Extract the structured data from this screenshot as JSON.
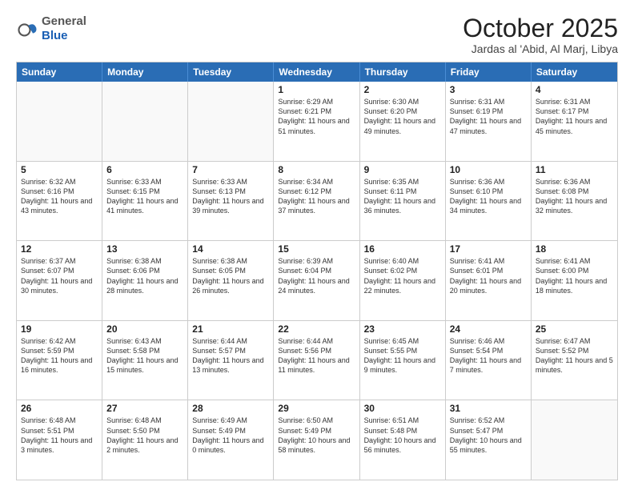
{
  "header": {
    "logo_general": "General",
    "logo_blue": "Blue",
    "month_title": "October 2025",
    "subtitle": "Jardas al 'Abid, Al Marj, Libya"
  },
  "calendar": {
    "days_of_week": [
      "Sunday",
      "Monday",
      "Tuesday",
      "Wednesday",
      "Thursday",
      "Friday",
      "Saturday"
    ],
    "rows": [
      [
        {
          "day": "",
          "sunrise": "",
          "sunset": "",
          "daylight": ""
        },
        {
          "day": "",
          "sunrise": "",
          "sunset": "",
          "daylight": ""
        },
        {
          "day": "",
          "sunrise": "",
          "sunset": "",
          "daylight": ""
        },
        {
          "day": "1",
          "sunrise": "Sunrise: 6:29 AM",
          "sunset": "Sunset: 6:21 PM",
          "daylight": "Daylight: 11 hours and 51 minutes."
        },
        {
          "day": "2",
          "sunrise": "Sunrise: 6:30 AM",
          "sunset": "Sunset: 6:20 PM",
          "daylight": "Daylight: 11 hours and 49 minutes."
        },
        {
          "day": "3",
          "sunrise": "Sunrise: 6:31 AM",
          "sunset": "Sunset: 6:19 PM",
          "daylight": "Daylight: 11 hours and 47 minutes."
        },
        {
          "day": "4",
          "sunrise": "Sunrise: 6:31 AM",
          "sunset": "Sunset: 6:17 PM",
          "daylight": "Daylight: 11 hours and 45 minutes."
        }
      ],
      [
        {
          "day": "5",
          "sunrise": "Sunrise: 6:32 AM",
          "sunset": "Sunset: 6:16 PM",
          "daylight": "Daylight: 11 hours and 43 minutes."
        },
        {
          "day": "6",
          "sunrise": "Sunrise: 6:33 AM",
          "sunset": "Sunset: 6:15 PM",
          "daylight": "Daylight: 11 hours and 41 minutes."
        },
        {
          "day": "7",
          "sunrise": "Sunrise: 6:33 AM",
          "sunset": "Sunset: 6:13 PM",
          "daylight": "Daylight: 11 hours and 39 minutes."
        },
        {
          "day": "8",
          "sunrise": "Sunrise: 6:34 AM",
          "sunset": "Sunset: 6:12 PM",
          "daylight": "Daylight: 11 hours and 37 minutes."
        },
        {
          "day": "9",
          "sunrise": "Sunrise: 6:35 AM",
          "sunset": "Sunset: 6:11 PM",
          "daylight": "Daylight: 11 hours and 36 minutes."
        },
        {
          "day": "10",
          "sunrise": "Sunrise: 6:36 AM",
          "sunset": "Sunset: 6:10 PM",
          "daylight": "Daylight: 11 hours and 34 minutes."
        },
        {
          "day": "11",
          "sunrise": "Sunrise: 6:36 AM",
          "sunset": "Sunset: 6:08 PM",
          "daylight": "Daylight: 11 hours and 32 minutes."
        }
      ],
      [
        {
          "day": "12",
          "sunrise": "Sunrise: 6:37 AM",
          "sunset": "Sunset: 6:07 PM",
          "daylight": "Daylight: 11 hours and 30 minutes."
        },
        {
          "day": "13",
          "sunrise": "Sunrise: 6:38 AM",
          "sunset": "Sunset: 6:06 PM",
          "daylight": "Daylight: 11 hours and 28 minutes."
        },
        {
          "day": "14",
          "sunrise": "Sunrise: 6:38 AM",
          "sunset": "Sunset: 6:05 PM",
          "daylight": "Daylight: 11 hours and 26 minutes."
        },
        {
          "day": "15",
          "sunrise": "Sunrise: 6:39 AM",
          "sunset": "Sunset: 6:04 PM",
          "daylight": "Daylight: 11 hours and 24 minutes."
        },
        {
          "day": "16",
          "sunrise": "Sunrise: 6:40 AM",
          "sunset": "Sunset: 6:02 PM",
          "daylight": "Daylight: 11 hours and 22 minutes."
        },
        {
          "day": "17",
          "sunrise": "Sunrise: 6:41 AM",
          "sunset": "Sunset: 6:01 PM",
          "daylight": "Daylight: 11 hours and 20 minutes."
        },
        {
          "day": "18",
          "sunrise": "Sunrise: 6:41 AM",
          "sunset": "Sunset: 6:00 PM",
          "daylight": "Daylight: 11 hours and 18 minutes."
        }
      ],
      [
        {
          "day": "19",
          "sunrise": "Sunrise: 6:42 AM",
          "sunset": "Sunset: 5:59 PM",
          "daylight": "Daylight: 11 hours and 16 minutes."
        },
        {
          "day": "20",
          "sunrise": "Sunrise: 6:43 AM",
          "sunset": "Sunset: 5:58 PM",
          "daylight": "Daylight: 11 hours and 15 minutes."
        },
        {
          "day": "21",
          "sunrise": "Sunrise: 6:44 AM",
          "sunset": "Sunset: 5:57 PM",
          "daylight": "Daylight: 11 hours and 13 minutes."
        },
        {
          "day": "22",
          "sunrise": "Sunrise: 6:44 AM",
          "sunset": "Sunset: 5:56 PM",
          "daylight": "Daylight: 11 hours and 11 minutes."
        },
        {
          "day": "23",
          "sunrise": "Sunrise: 6:45 AM",
          "sunset": "Sunset: 5:55 PM",
          "daylight": "Daylight: 11 hours and 9 minutes."
        },
        {
          "day": "24",
          "sunrise": "Sunrise: 6:46 AM",
          "sunset": "Sunset: 5:54 PM",
          "daylight": "Daylight: 11 hours and 7 minutes."
        },
        {
          "day": "25",
          "sunrise": "Sunrise: 6:47 AM",
          "sunset": "Sunset: 5:52 PM",
          "daylight": "Daylight: 11 hours and 5 minutes."
        }
      ],
      [
        {
          "day": "26",
          "sunrise": "Sunrise: 6:48 AM",
          "sunset": "Sunset: 5:51 PM",
          "daylight": "Daylight: 11 hours and 3 minutes."
        },
        {
          "day": "27",
          "sunrise": "Sunrise: 6:48 AM",
          "sunset": "Sunset: 5:50 PM",
          "daylight": "Daylight: 11 hours and 2 minutes."
        },
        {
          "day": "28",
          "sunrise": "Sunrise: 6:49 AM",
          "sunset": "Sunset: 5:49 PM",
          "daylight": "Daylight: 11 hours and 0 minutes."
        },
        {
          "day": "29",
          "sunrise": "Sunrise: 6:50 AM",
          "sunset": "Sunset: 5:49 PM",
          "daylight": "Daylight: 10 hours and 58 minutes."
        },
        {
          "day": "30",
          "sunrise": "Sunrise: 6:51 AM",
          "sunset": "Sunset: 5:48 PM",
          "daylight": "Daylight: 10 hours and 56 minutes."
        },
        {
          "day": "31",
          "sunrise": "Sunrise: 6:52 AM",
          "sunset": "Sunset: 5:47 PM",
          "daylight": "Daylight: 10 hours and 55 minutes."
        },
        {
          "day": "",
          "sunrise": "",
          "sunset": "",
          "daylight": ""
        }
      ]
    ]
  }
}
